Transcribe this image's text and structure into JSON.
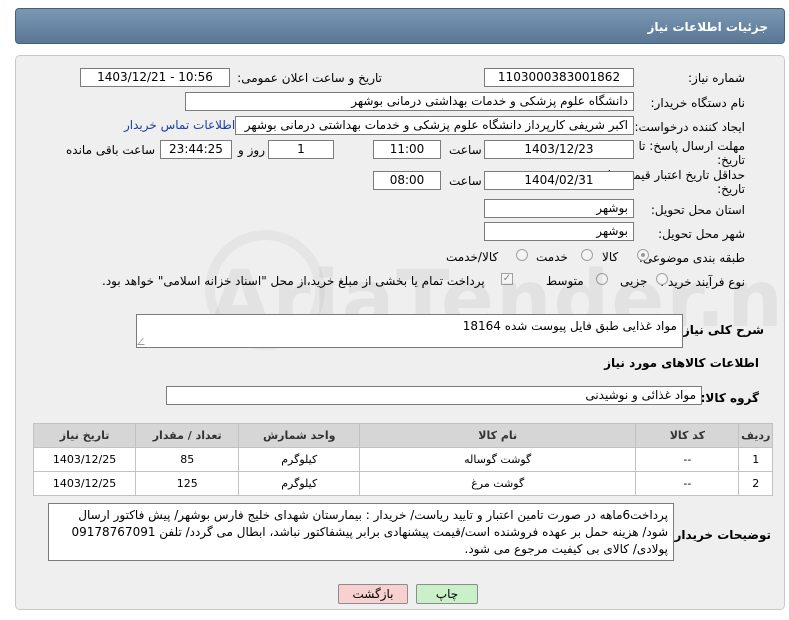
{
  "header": {
    "title": "جزئیات اطلاعات نیاز"
  },
  "fields": {
    "need_number_label": "شماره نیاز:",
    "need_number": "1103000383001862",
    "announce_label": "تاریخ و ساعت اعلان عمومی:",
    "announce_value": "1403/12/21 - 10:56",
    "buyer_org_label": "نام دستگاه خریدار:",
    "buyer_org": "دانشگاه علوم پزشکی و خدمات بهداشتی درمانی بوشهر",
    "creator_label": "ایجاد کننده درخواست:",
    "creator": "اکبر شریفی کارپرداز دانشگاه علوم پزشکی و خدمات بهداشتی درمانی بوشهر",
    "contact_link": "اطلاعات تماس خریدار",
    "deadline_label_1": "مهلت ارسال پاسخ: تا",
    "deadline_label_2": "تاریخ:",
    "deadline_date": "1403/12/23",
    "time_label": "ساعت",
    "deadline_time": "11:00",
    "days_value": "1",
    "days_label": "روز و",
    "remaining_time": "23:44:25",
    "remaining_label": "ساعت باقی مانده",
    "validity_label_1": "حداقل تاریخ اعتبار قیمت: تا",
    "validity_label_2": "تاریخ:",
    "validity_date": "1404/02/31",
    "validity_time_label": "ساعت",
    "validity_time": "08:00",
    "province_label": "استان محل تحویل:",
    "province": "بوشهر",
    "city_label": "شهر محل تحویل:",
    "city": "بوشهر",
    "category_label": "طبقه بندی موضوعی:",
    "category_options": [
      "کالا",
      "خدمت",
      "کالا/خدمت"
    ],
    "process_label": "نوع فرآیند خرید :",
    "process_options": [
      "جزیی",
      "متوسط"
    ],
    "payment_note": "پرداخت تمام یا بخشی از مبلغ خرید،از محل \"اسناد خزانه اسلامی\" خواهد بود.",
    "summary_label": "شرح کلی نیاز:",
    "summary": "مواد غذایی طبق فایل پیوست شده 18164",
    "goods_info_title": "اطلاعات کالاهای مورد نیاز",
    "goods_group_label": "گروه کالا:",
    "goods_group": "مواد غذائی و نوشیدنی"
  },
  "table": {
    "headers": [
      "ردیف",
      "کد کالا",
      "نام کالا",
      "واحد شمارش",
      "تعداد / مقدار",
      "تاریخ نیاز"
    ],
    "rows": [
      {
        "idx": "1",
        "code": "--",
        "name": "گوشت گوساله",
        "unit": "کیلوگرم",
        "qty": "85",
        "date": "1403/12/25"
      },
      {
        "idx": "2",
        "code": "--",
        "name": "گوشت مرغ",
        "unit": "کیلوگرم",
        "qty": "125",
        "date": "1403/12/25"
      }
    ]
  },
  "buyer_notes_label": "توضیحات خریدار:",
  "buyer_notes": "پرداخت6ماهه در صورت تامین اعتبار و تایید ریاست/ خریدار : بیمارستان شهدای خلیج فارس بوشهر/ پیش فاکتور ارسال شود/ هزینه حمل بر عهده فروشنده است/قیمت پیشنهادی برابر پیشفاکتور نباشد، ابطال می گردد/ تلفن 09178767091 پولادی/ کالای بی کیفیت مرجوع می شود.",
  "buttons": {
    "print": "چاپ",
    "back": "بازگشت"
  },
  "colors": {
    "header": "#5f7d99",
    "print_btn": "#c9f0c9",
    "back_btn": "#f7d0d0",
    "link": "#1a3fa0"
  }
}
